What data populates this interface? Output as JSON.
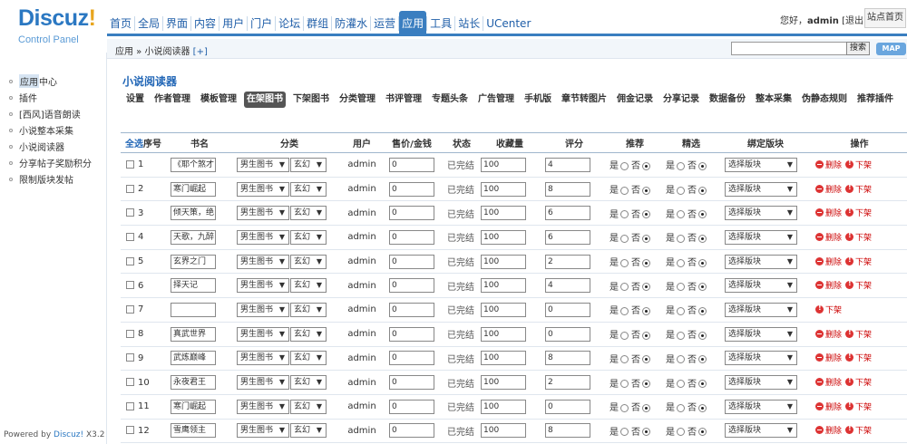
{
  "brand": {
    "logo_main": "Discuz",
    "logo_mark": "!",
    "logo_sub": "Control Panel"
  },
  "nav": [
    {
      "label": "首页",
      "active": false
    },
    {
      "label": "全局",
      "active": false
    },
    {
      "label": "界面",
      "active": false
    },
    {
      "label": "内容",
      "active": false
    },
    {
      "label": "用户",
      "active": false
    },
    {
      "label": "门户",
      "active": false
    },
    {
      "label": "论坛",
      "active": false
    },
    {
      "label": "群组",
      "active": false
    },
    {
      "label": "防灌水",
      "active": false
    },
    {
      "label": "运营",
      "active": false
    },
    {
      "label": "应用",
      "active": true
    },
    {
      "label": "工具",
      "active": false
    },
    {
      "label": "站长",
      "active": false
    },
    {
      "label": "UCenter",
      "active": false
    }
  ],
  "user": {
    "greeting": "您好，",
    "name": "admin",
    "logout": "[退出]",
    "site_home": "站点首页"
  },
  "sidebar": {
    "items": [
      {
        "label": "应用",
        "label_suffix": "中心",
        "current": true
      },
      {
        "label": "插件",
        "label_suffix": "",
        "current": false
      },
      {
        "label": "[西风]语音朗读",
        "label_suffix": "",
        "current": false
      },
      {
        "label": "小说整本采集",
        "label_suffix": "",
        "current": false
      },
      {
        "label": "小说阅读器",
        "label_suffix": "",
        "current": false
      },
      {
        "label": "分享帖子奖励积分",
        "label_suffix": "",
        "current": false
      },
      {
        "label": "限制版块发帖",
        "label_suffix": "",
        "current": false
      }
    ],
    "powered_prefix": "Powered by ",
    "powered_brand": "Discuz!",
    "powered_version": " X3.2"
  },
  "breadcrumb": {
    "text": "应用 » 小说阅读器",
    "plus": "[+]"
  },
  "search": {
    "value": "",
    "button": "搜索",
    "map_button": "MAP"
  },
  "plugin_title": "小说阅读器",
  "tabs": [
    {
      "label": "设置",
      "active": false
    },
    {
      "label": "作者管理",
      "active": false
    },
    {
      "label": "模板管理",
      "active": false
    },
    {
      "label": "在架图书",
      "active": true
    },
    {
      "label": "下架图书",
      "active": false
    },
    {
      "label": "分类管理",
      "active": false
    },
    {
      "label": "书评管理",
      "active": false
    },
    {
      "label": "专题头条",
      "active": false
    },
    {
      "label": "广告管理",
      "active": false
    },
    {
      "label": "手机版",
      "active": false
    },
    {
      "label": "章节转图片",
      "active": false
    },
    {
      "label": "佣金记录",
      "active": false
    },
    {
      "label": "分享记录",
      "active": false
    },
    {
      "label": "数据备份",
      "active": false
    },
    {
      "label": "整本采集",
      "active": false
    },
    {
      "label": "伪静态规则",
      "active": false
    },
    {
      "label": "推荐插件",
      "active": false
    }
  ],
  "table": {
    "headers": {
      "select_all": "全选",
      "seq": "序号",
      "title": "书名",
      "category": "分类",
      "user": "用户",
      "price": "售价/金钱",
      "status": "状态",
      "favorites": "收藏量",
      "rating": "评分",
      "recommend": "推荐",
      "featured": "精选",
      "bind_block": "绑定版块",
      "action": "操作"
    },
    "labels": {
      "yes": "是",
      "no": "否",
      "block_placeholder": "选择版块",
      "delete": "删除",
      "unshelve": "下架"
    },
    "rows": [
      {
        "seq": "1",
        "title": "《耶个煞才",
        "cat1": "男生图书",
        "cat2": "玄幻",
        "user": "admin",
        "price": "0",
        "status": "已完结",
        "favorites": "100",
        "rating": "4",
        "recommend": "no",
        "featured": "no",
        "deletable": true
      },
      {
        "seq": "2",
        "title": "寒门崛起",
        "cat1": "男生图书",
        "cat2": "玄幻",
        "user": "admin",
        "price": "0",
        "status": "已完结",
        "favorites": "100",
        "rating": "8",
        "recommend": "no",
        "featured": "no",
        "deletable": true
      },
      {
        "seq": "3",
        "title": "倾天策，绝",
        "cat1": "男生图书",
        "cat2": "玄幻",
        "user": "admin",
        "price": "0",
        "status": "已完结",
        "favorites": "100",
        "rating": "6",
        "recommend": "no",
        "featured": "no",
        "deletable": true
      },
      {
        "seq": "4",
        "title": "天歌，九醉",
        "cat1": "男生图书",
        "cat2": "玄幻",
        "user": "admin",
        "price": "0",
        "status": "已完结",
        "favorites": "100",
        "rating": "6",
        "recommend": "no",
        "featured": "no",
        "deletable": true
      },
      {
        "seq": "5",
        "title": "玄界之门",
        "cat1": "男生图书",
        "cat2": "玄幻",
        "user": "admin",
        "price": "0",
        "status": "已完结",
        "favorites": "100",
        "rating": "2",
        "recommend": "no",
        "featured": "no",
        "deletable": true
      },
      {
        "seq": "6",
        "title": "择天记",
        "cat1": "男生图书",
        "cat2": "玄幻",
        "user": "admin",
        "price": "0",
        "status": "已完结",
        "favorites": "100",
        "rating": "4",
        "recommend": "no",
        "featured": "no",
        "deletable": true
      },
      {
        "seq": "7",
        "title": "",
        "cat1": "男生图书",
        "cat2": "玄幻",
        "user": "admin",
        "price": "0",
        "status": "已完结",
        "favorites": "100",
        "rating": "0",
        "recommend": "no",
        "featured": "no",
        "deletable": false
      },
      {
        "seq": "8",
        "title": "真武世界",
        "cat1": "男生图书",
        "cat2": "玄幻",
        "user": "admin",
        "price": "0",
        "status": "已完结",
        "favorites": "100",
        "rating": "0",
        "recommend": "no",
        "featured": "no",
        "deletable": true
      },
      {
        "seq": "9",
        "title": "武炼巅峰",
        "cat1": "男生图书",
        "cat2": "玄幻",
        "user": "admin",
        "price": "0",
        "status": "已完结",
        "favorites": "100",
        "rating": "8",
        "recommend": "no",
        "featured": "no",
        "deletable": true
      },
      {
        "seq": "10",
        "title": "永夜君王",
        "cat1": "男生图书",
        "cat2": "玄幻",
        "user": "admin",
        "price": "0",
        "status": "已完结",
        "favorites": "100",
        "rating": "2",
        "recommend": "no",
        "featured": "no",
        "deletable": true
      },
      {
        "seq": "11",
        "title": "寒门崛起",
        "cat1": "男生图书",
        "cat2": "玄幻",
        "user": "admin",
        "price": "0",
        "status": "已完结",
        "favorites": "100",
        "rating": "0",
        "recommend": "no",
        "featured": "no",
        "deletable": true
      },
      {
        "seq": "12",
        "title": "雪鹰领主",
        "cat1": "男生图书",
        "cat2": "玄幻",
        "user": "admin",
        "price": "0",
        "status": "已完结",
        "favorites": "100",
        "rating": "8",
        "recommend": "no",
        "featured": "no",
        "deletable": true
      }
    ]
  },
  "colors": {
    "accent": "#3a7ec0",
    "link": "#1f5ea8",
    "danger": "#cc0000"
  }
}
